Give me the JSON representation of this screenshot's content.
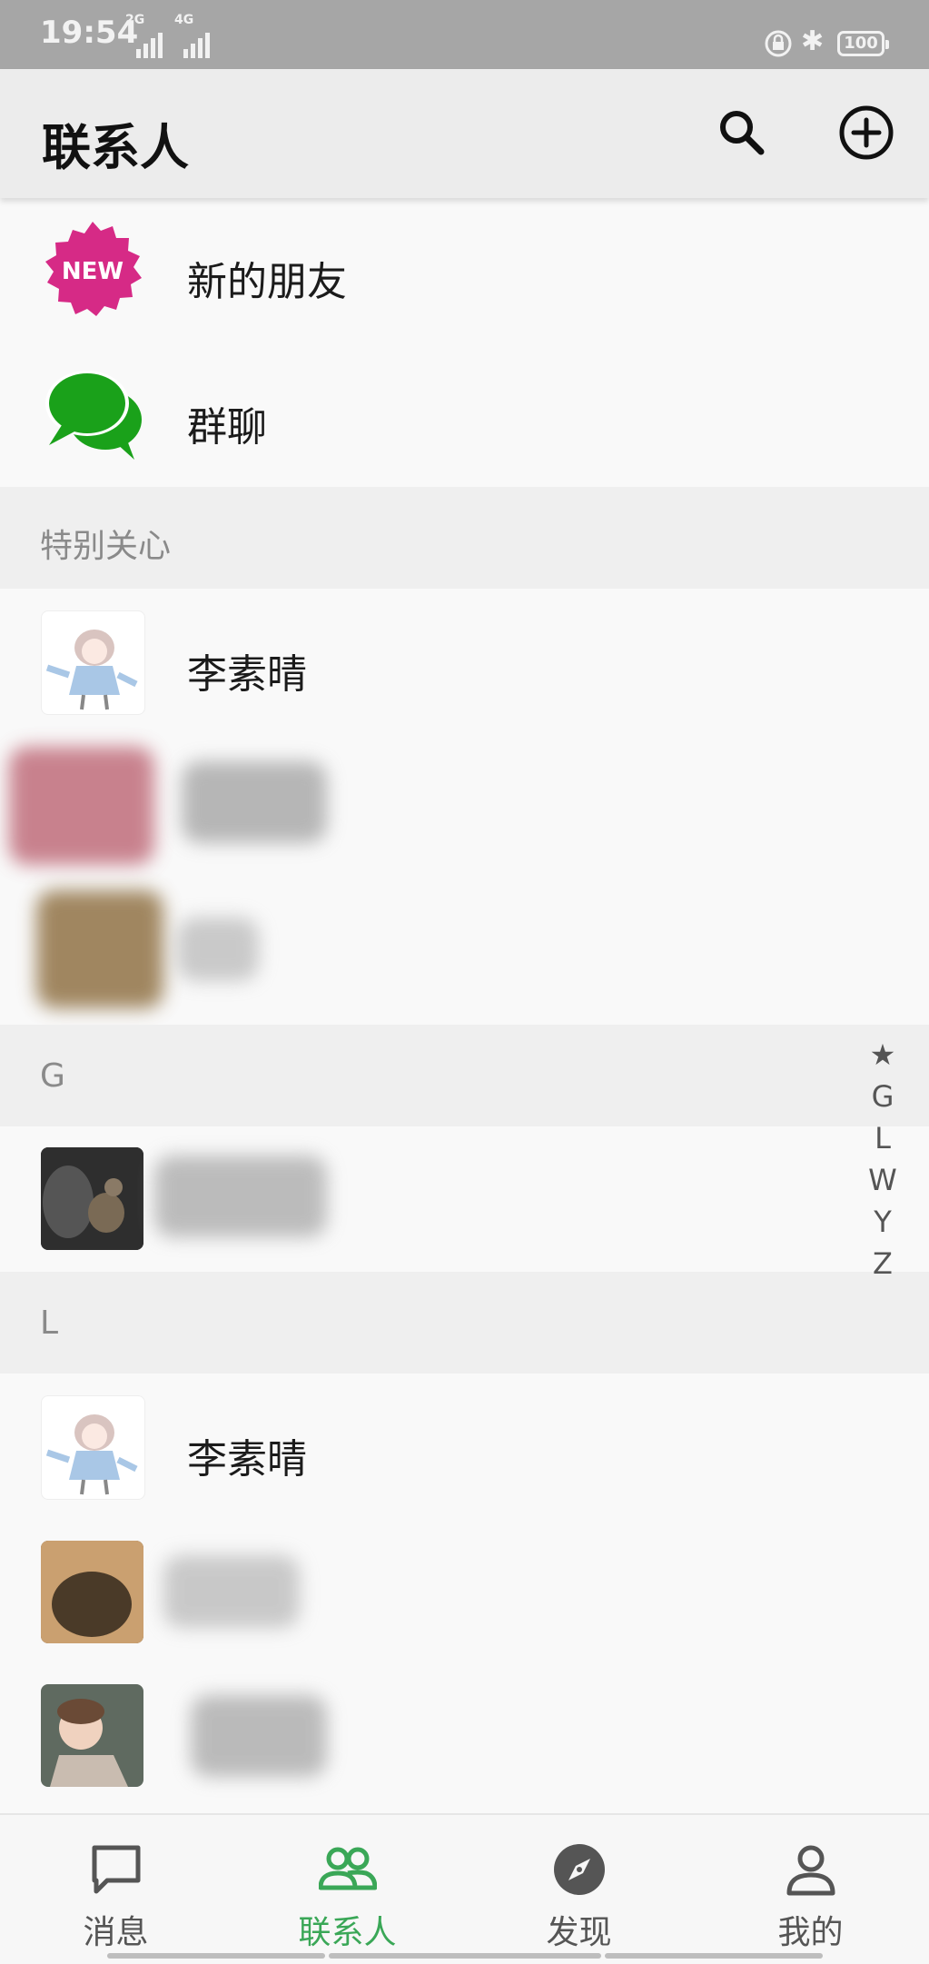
{
  "status_bar": {
    "time": "19:54",
    "network_1": "2G",
    "network_2": "4G",
    "battery": "100"
  },
  "header": {
    "title": "联系人"
  },
  "top_items": [
    {
      "label": "新的朋友",
      "icon": "new-badge-icon",
      "badge_text": "NEW",
      "badge_color": "#d62a86"
    },
    {
      "label": "群聊",
      "icon": "group-chat-icon",
      "icon_color": "#1aa11a"
    }
  ],
  "sections": {
    "special": {
      "title": "特别关心"
    },
    "g": {
      "title": "G"
    },
    "l": {
      "title": "L"
    }
  },
  "contacts": {
    "special_1": "李素晴",
    "l_1": "李素晴"
  },
  "index_bar": [
    "★",
    "G",
    "L",
    "W",
    "Y",
    "Z"
  ],
  "tabs": [
    {
      "label": "消息",
      "icon": "message-icon"
    },
    {
      "label": "联系人",
      "icon": "contacts-icon",
      "active": true
    },
    {
      "label": "发现",
      "icon": "compass-icon"
    },
    {
      "label": "我的",
      "icon": "profile-icon"
    }
  ],
  "colors": {
    "accent": "#3aa757",
    "header_bg": "#ececec",
    "section_bg": "#efefef"
  }
}
